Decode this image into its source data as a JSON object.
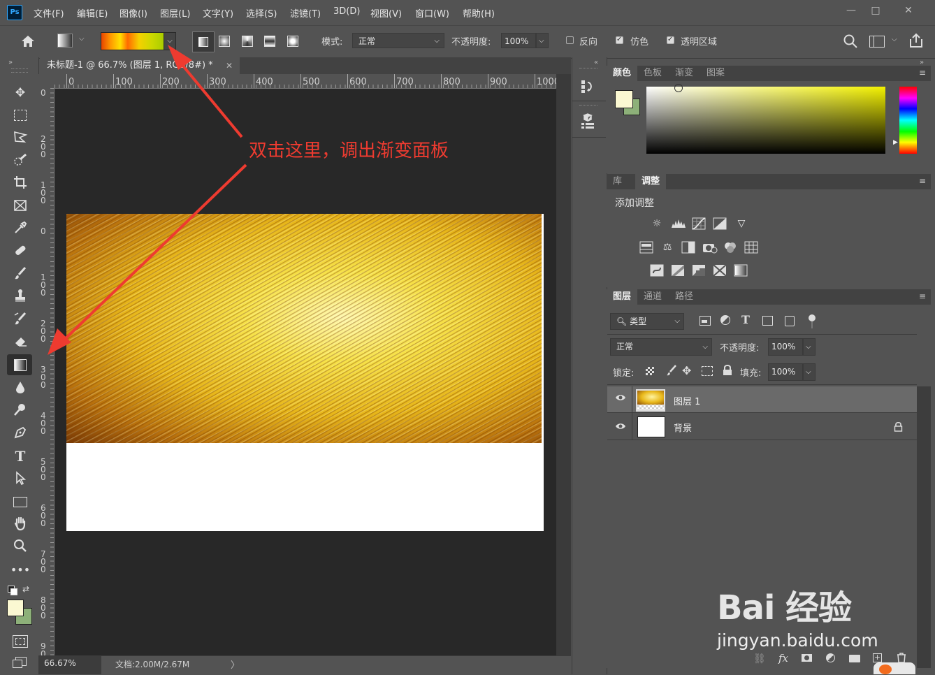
{
  "app": {
    "logo": "Ps",
    "menus": [
      "文件(F)",
      "编辑(E)",
      "图像(I)",
      "图层(L)",
      "文字(Y)",
      "选择(S)",
      "滤镜(T)",
      "3D(D)",
      "视图(V)",
      "窗口(W)",
      "帮助(H)"
    ],
    "window_buttons": [
      "—",
      "□",
      "✕"
    ]
  },
  "options_bar": {
    "mode_label": "模式:",
    "mode_value": "正常",
    "opacity_label": "不透明度:",
    "opacity_value": "100%",
    "reverse_label": "反向",
    "reverse_checked": false,
    "dither_label": "仿色",
    "dither_checked": true,
    "transparency_label": "透明区域",
    "transparency_checked": true
  },
  "document": {
    "tab_title": "未标题-1 @ 66.7% (图层 1, RGB/8#) *",
    "ruler_h": [
      "0",
      "100",
      "200",
      "300",
      "400",
      "500",
      "600",
      "700",
      "800",
      "900",
      "1000"
    ],
    "ruler_v": [
      "0",
      "200",
      "100",
      "0",
      "100",
      "200",
      "300",
      "400",
      "500",
      "600",
      "700",
      "800",
      "900"
    ],
    "zoom": "66.67%",
    "doc_size": "文档:2.00M/2.67M"
  },
  "annotation": {
    "text": "双击这里，调出渐变面板",
    "color": "#ee3b30"
  },
  "color_panel": {
    "tabs": [
      "颜色",
      "色板",
      "渐变",
      "图案"
    ],
    "foreground": "#fbf8d2",
    "background": "#8db079"
  },
  "adjust_panel": {
    "tabs": [
      "库",
      "调整"
    ],
    "title": "添加调整"
  },
  "layers_panel": {
    "tabs": [
      "图层",
      "通道",
      "路径"
    ],
    "filter_type": "类型",
    "blend_mode": "正常",
    "opacity_label": "不透明度:",
    "opacity_value": "100%",
    "lock_label": "锁定:",
    "fill_label": "填充:",
    "fill_value": "100%",
    "layers": [
      {
        "name": "图层 1",
        "selected": true
      },
      {
        "name": "背景",
        "locked": true
      }
    ],
    "footer_icons": [
      "link-icon",
      "fx-icon",
      "mask-icon",
      "adjustment-icon",
      "folder-icon",
      "new-layer-icon",
      "trash-icon"
    ]
  },
  "watermark": {
    "brand": "Bai 经验",
    "url": "jingyan.baidu.com"
  }
}
